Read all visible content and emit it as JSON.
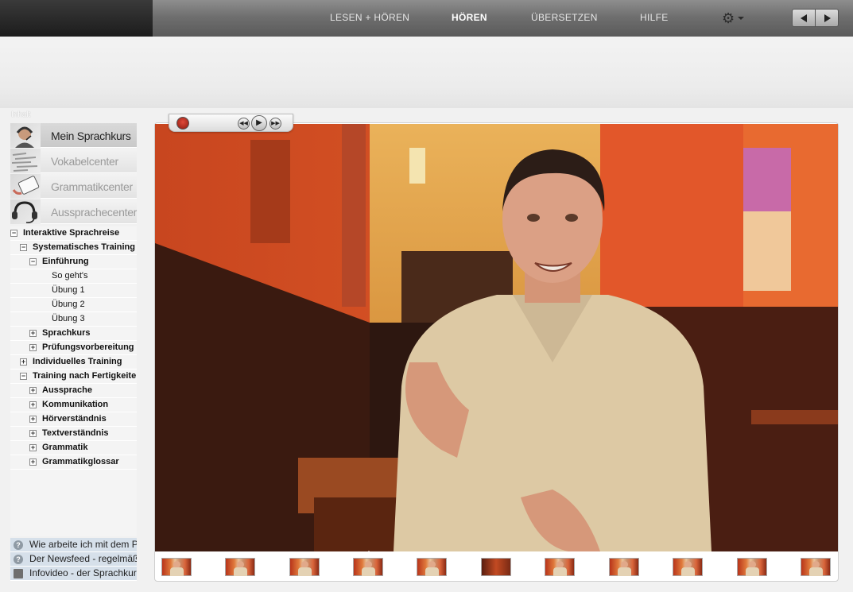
{
  "nav": {
    "tabs": [
      {
        "label": "LESEN + HÖREN"
      },
      {
        "label": "HÖREN"
      },
      {
        "label": "ÜBERSETZEN"
      },
      {
        "label": "HILFE"
      }
    ],
    "active_tab": "HÖREN",
    "settings_icon": "gear-icon",
    "prev_icon": "arrow-left-icon",
    "next_icon": "arrow-right-icon"
  },
  "sidebar": {
    "heading": "Inhalt",
    "modules": [
      {
        "label": "Mein Sprachkurs",
        "icon": "headset-person-icon",
        "active": true
      },
      {
        "label": "Vokabelcenter",
        "icon": "word-cloud-icon",
        "active": false
      },
      {
        "label": "Grammatikcenter",
        "icon": "notebook-pen-icon",
        "active": false
      },
      {
        "label": "Aussprachecenter",
        "icon": "headset-icon",
        "active": false
      }
    ],
    "tree": [
      {
        "label": "Interaktive Sprachreise",
        "toggle": "−"
      },
      {
        "label": "Systematisches Training",
        "toggle": "−"
      },
      {
        "label": "Einführung",
        "toggle": "−"
      },
      {
        "label": "So geht's",
        "toggle": ""
      },
      {
        "label": "Übung 1",
        "toggle": ""
      },
      {
        "label": "Übung 2",
        "toggle": ""
      },
      {
        "label": "Übung 3",
        "toggle": ""
      },
      {
        "label": "Sprachkurs",
        "toggle": "+"
      },
      {
        "label": "Prüfungsvorbereitung",
        "toggle": "+"
      },
      {
        "label": "Individuelles Training",
        "toggle": "+"
      },
      {
        "label": "Training nach Fertigkeiten",
        "toggle": "−"
      },
      {
        "label": "Aussprache",
        "toggle": "+"
      },
      {
        "label": "Kommunikation",
        "toggle": "+"
      },
      {
        "label": "Hörverständnis",
        "toggle": "+"
      },
      {
        "label": "Textverständnis",
        "toggle": "+"
      },
      {
        "label": "Grammatik",
        "toggle": "+"
      },
      {
        "label": "Grammatikglossar",
        "toggle": "+"
      }
    ],
    "help_links": [
      {
        "label": "Wie arbeite ich mit dem Programm?",
        "icon": "help-icon",
        "glyph": "?"
      },
      {
        "label": "Der Newsfeed - regelmäßig",
        "icon": "help-icon",
        "glyph": "?"
      },
      {
        "label": "Infovideo - der Sprachkurs",
        "icon": "film-icon",
        "glyph": ""
      }
    ]
  },
  "player": {
    "record_icon": "record-icon",
    "rewind_icon": "rewind-icon",
    "play_icon": "play-icon",
    "forward_icon": "fast-forward-icon",
    "rewind_glyph": "◀◀",
    "play_glyph": "▶",
    "forward_glyph": "▶▶"
  },
  "video": {
    "description_icon": "video-frame",
    "thumbnail_count": 11,
    "current_thumbnail": 4
  },
  "colors": {
    "topbar": "#6f6f6f",
    "accent_wall": "#e8622c"
  }
}
